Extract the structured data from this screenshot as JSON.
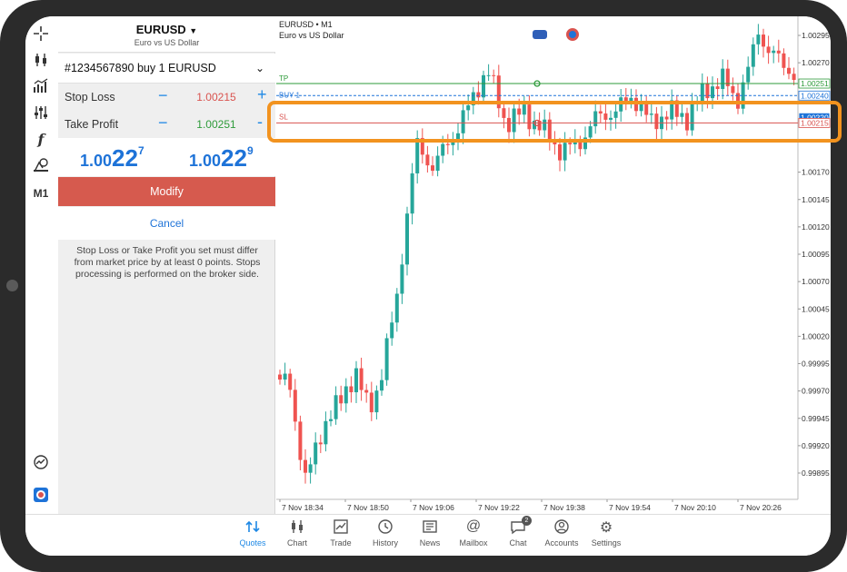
{
  "symbol": {
    "name": "EURUSD",
    "description": "Euro vs US Dollar"
  },
  "order": {
    "label": "#1234567890  buy 1 EURUSD"
  },
  "stop_loss": {
    "label": "Stop Loss",
    "value": "1.00215",
    "color": "#d9534f"
  },
  "take_profit": {
    "label": "Take Profit",
    "value": "1.00251",
    "color": "#2e9b3a"
  },
  "prices": {
    "bid": {
      "prefix": "1.00",
      "big": "22",
      "sup": "7"
    },
    "ask": {
      "prefix": "1.00",
      "big": "22",
      "sup": "9"
    }
  },
  "buttons": {
    "modify": "Modify",
    "cancel": "Cancel"
  },
  "note": "Stop Loss or Take Profit you set must differ from market price by at least 0 points. Stops processing is performed on the broker side.",
  "chart": {
    "title": "EURUSD • M1",
    "subtitle": "Euro vs US Dollar",
    "lines": {
      "tp": "TP",
      "buy": "BUY 1",
      "sl": "SL"
    },
    "price_labels": [
      "1.00295",
      "1.00270",
      "1.00251",
      "1.00240",
      "1.00220",
      "1.00215",
      "1.00170",
      "1.00145",
      "1.00120",
      "1.00095",
      "1.00070",
      "1.00045",
      "1.00020",
      "0.99995",
      "0.99970",
      "0.99945",
      "0.99920",
      "0.99895"
    ],
    "time_labels": [
      "7 Nov 18:34",
      "7 Nov 18:50",
      "7 Nov 19:06",
      "7 Nov 19:22",
      "7 Nov 19:38",
      "7 Nov 19:54",
      "7 Nov 20:10",
      "7 Nov 20:26"
    ],
    "colors": {
      "up": "#26a69a",
      "down": "#ef5350",
      "tp": "#2e9b3a",
      "sl": "#d9534f",
      "buy": "#1e73d8",
      "highlight": "#f2931f"
    }
  },
  "nav": [
    {
      "label": "Quotes",
      "icon": "quotes-icon",
      "active": true
    },
    {
      "label": "Chart",
      "icon": "chart-icon"
    },
    {
      "label": "Trade",
      "icon": "trade-icon"
    },
    {
      "label": "History",
      "icon": "history-icon"
    },
    {
      "label": "News",
      "icon": "news-icon"
    },
    {
      "label": "Mailbox",
      "icon": "mailbox-icon"
    },
    {
      "label": "Chat",
      "icon": "chat-icon",
      "badge": "2"
    },
    {
      "label": "Accounts",
      "icon": "accounts-icon"
    },
    {
      "label": "Settings",
      "icon": "settings-icon"
    }
  ],
  "toolbar": {
    "timeframe": "M1"
  }
}
